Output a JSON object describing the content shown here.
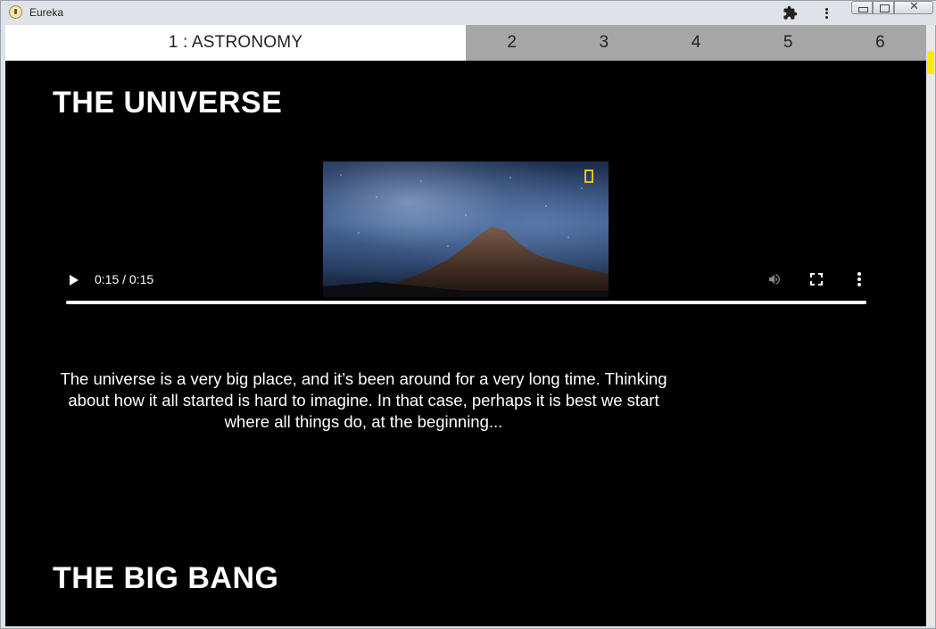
{
  "window": {
    "title": "Eureka"
  },
  "tabs": {
    "active": "1 : ASTRONOMY",
    "items": [
      "2",
      "3",
      "4",
      "5",
      "6"
    ]
  },
  "sections": {
    "universe_title": "THE UNIVERSE",
    "bigbang_title": "THE BIG BANG"
  },
  "video": {
    "time": "0:15 / 0:15",
    "progress": 1.0
  },
  "description": "The universe is a very big place, and it’s been around for a very long time. Thinking about how it all started is hard to imagine. In that case, perhaps it is best we start where all things do, at the beginning...",
  "colors": {
    "background": "#000000",
    "tab_inactive": "#a6a6a6",
    "tab_active": "#ffffff",
    "scroll_thumb": "#ffea00",
    "logo": "#e6c21a"
  },
  "icons": {
    "app": "eureka-app-icon",
    "extensions": "puzzle-icon",
    "menu": "kebab-menu-icon",
    "play": "play-icon",
    "volume": "volume-icon",
    "fullscreen": "fullscreen-icon",
    "more": "more-options-icon"
  }
}
